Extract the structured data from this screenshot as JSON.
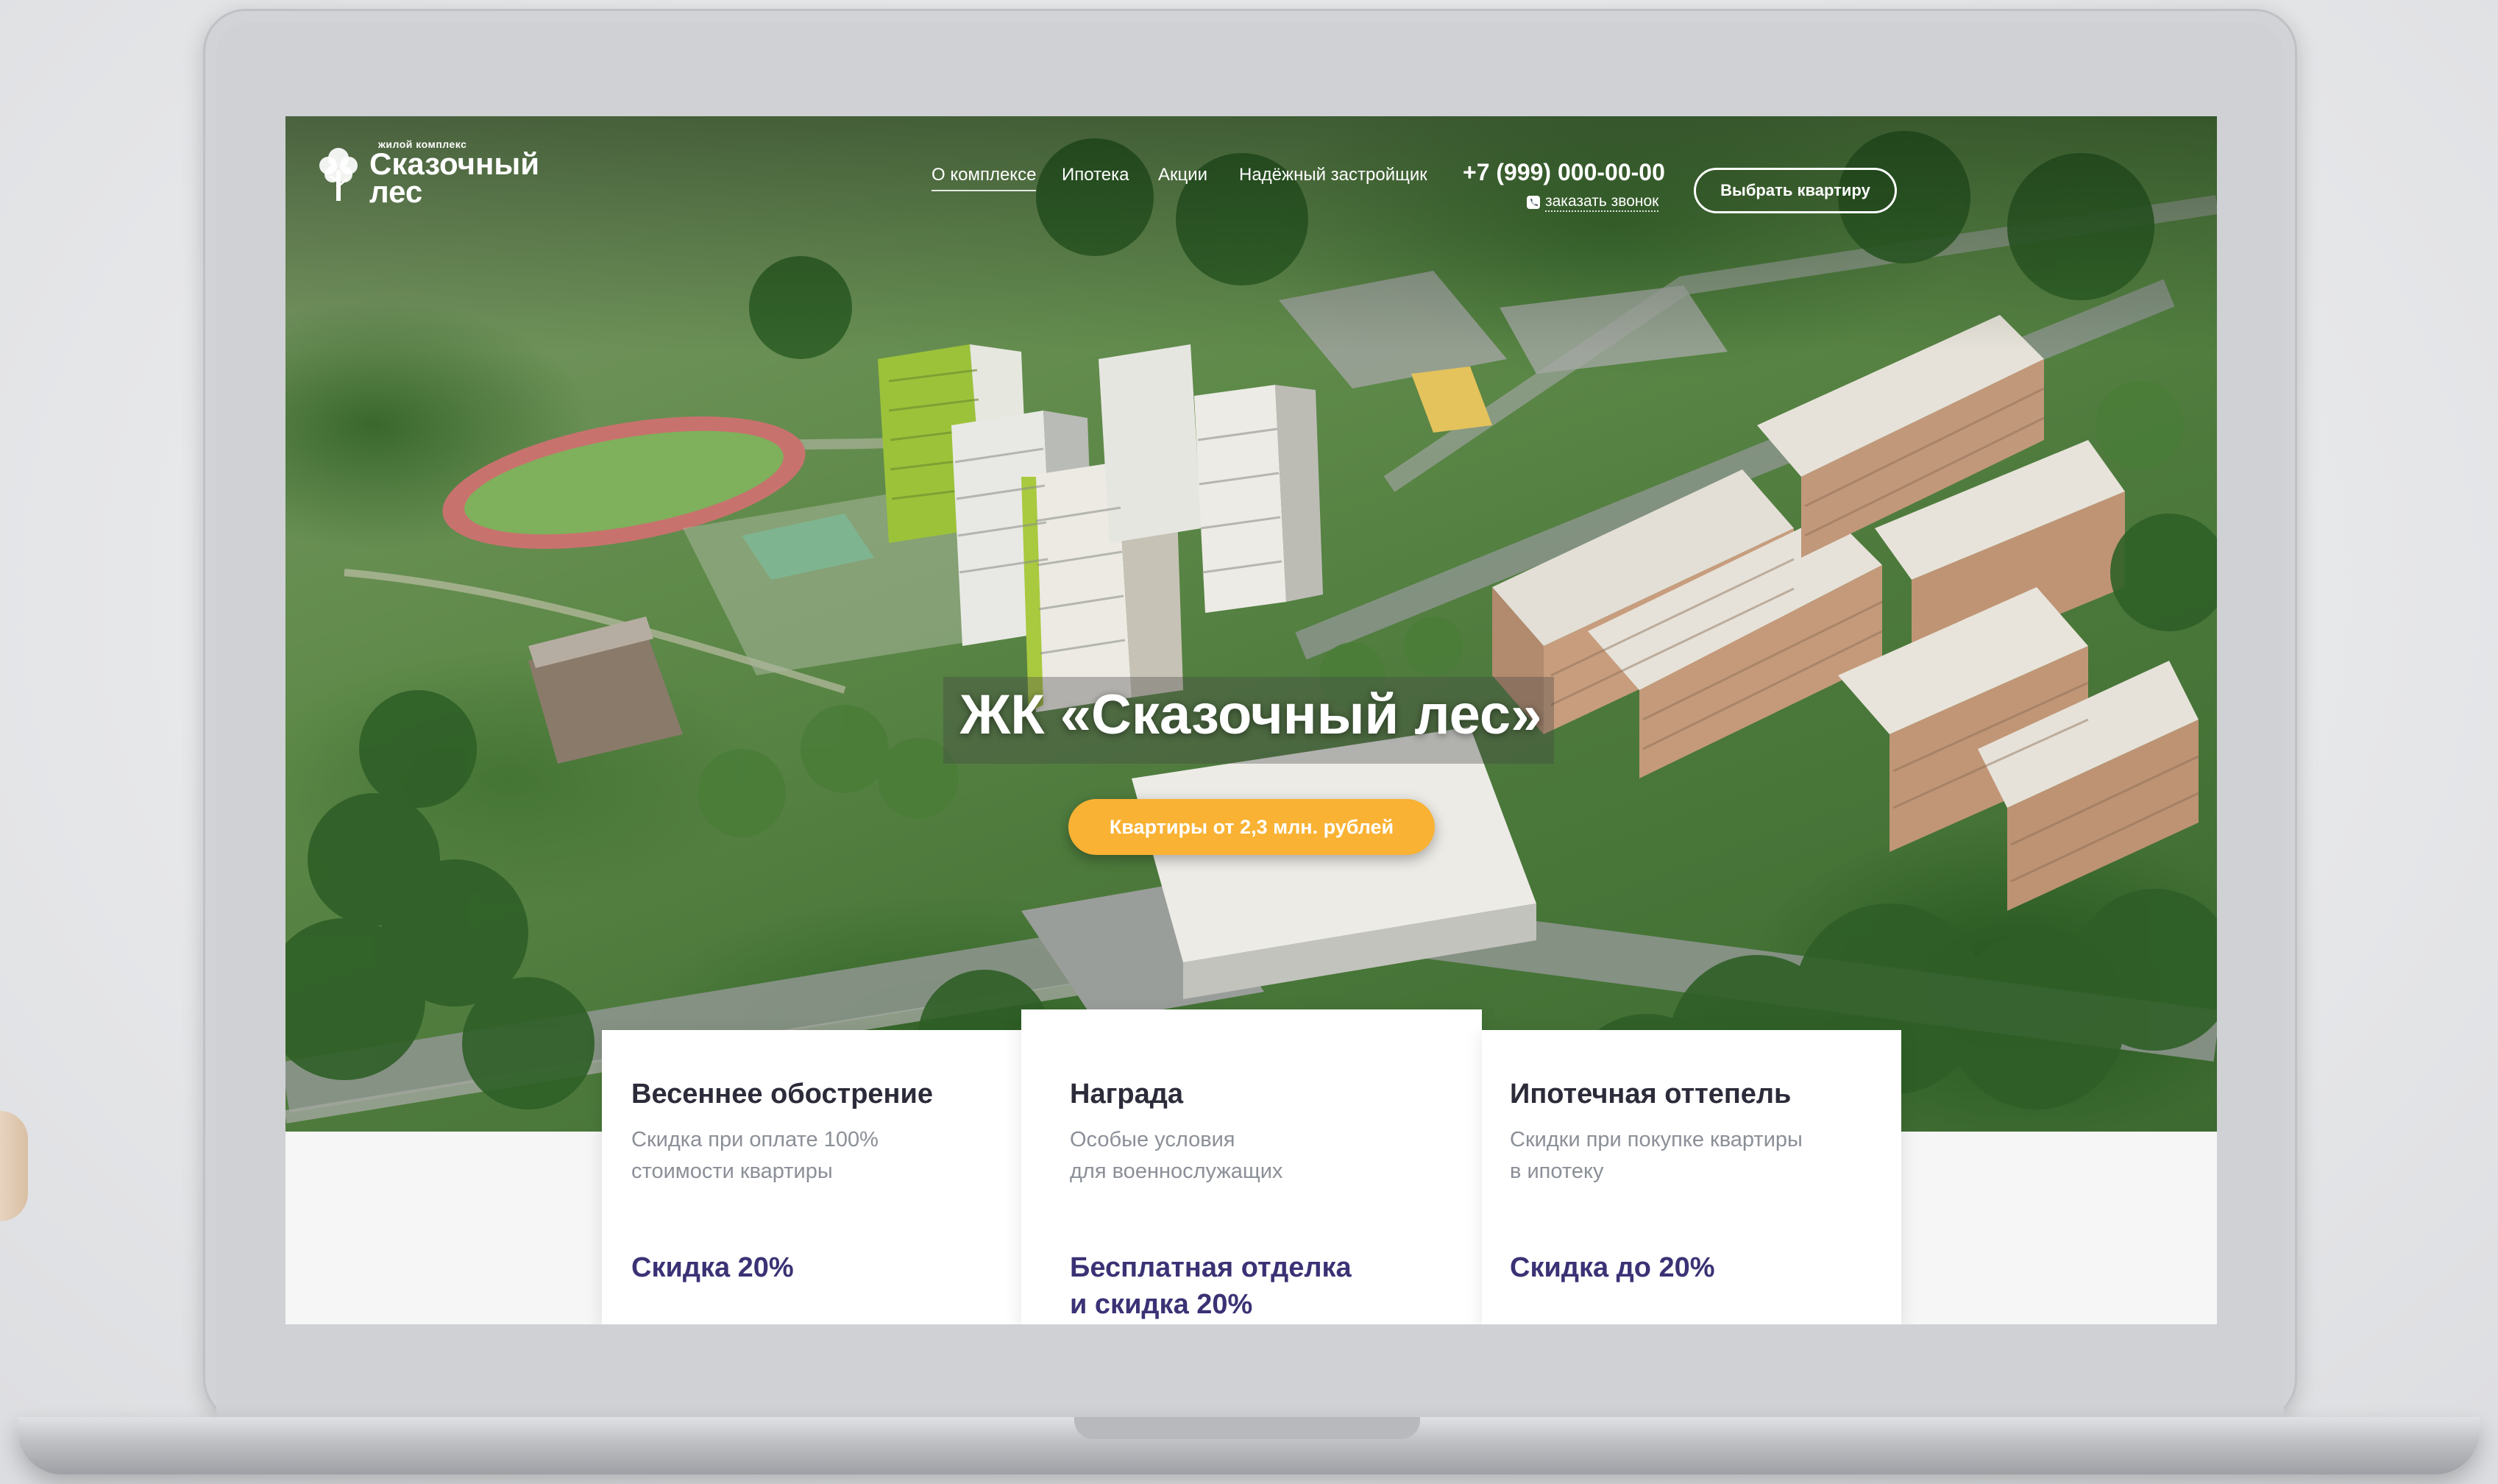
{
  "colors": {
    "accent": "#f9b234",
    "card_title": "#2b2b3a",
    "card_text": "#8b8f97",
    "offer_text": "#3a3275"
  },
  "header": {
    "logo_small": "жилой комплекс",
    "logo_line1": "Сказочный",
    "logo_line2": "лес",
    "logo_icon": "tree-icon",
    "nav": [
      {
        "label": "О комплексе",
        "active": true
      },
      {
        "label": "Ипотека",
        "active": false
      },
      {
        "label": "Акции",
        "active": false
      },
      {
        "label": "Надёжный застройщик",
        "active": false
      }
    ],
    "phone": "+7 (999) 000-00-00",
    "callback": "заказать звонок",
    "callback_icon": "phone-icon",
    "choose_button": "Выбрать квартиру"
  },
  "hero": {
    "title": "ЖК «Сказочный лес»",
    "cta": "Квартиры от 2,3 млн. рублей"
  },
  "promos": [
    {
      "title": "Весеннее обострение",
      "desc_line1": "Скидка при оплате 100%",
      "desc_line2": "стоимости квартиры",
      "offer_line1": "Скидка 20%",
      "offer_line2": ""
    },
    {
      "title": "Награда",
      "desc_line1": "Особые условия",
      "desc_line2": "для военнослужащих",
      "offer_line1": "Бесплатная отделка",
      "offer_line2": "и скидка 20%"
    },
    {
      "title": "Ипотечная оттепель",
      "desc_line1": "Скидки при покупке квартиры",
      "desc_line2": "в ипотеку",
      "offer_line1": "Скидка до 20%",
      "offer_line2": ""
    }
  ]
}
